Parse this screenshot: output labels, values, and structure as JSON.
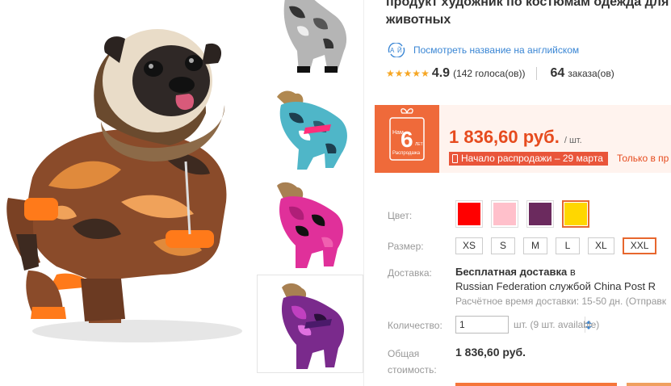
{
  "product": {
    "title_line1": "продукт художник по костюмам одежда для",
    "title_line2": "животных",
    "translate_link": "Посмотреть название на английском",
    "rating": {
      "stars": 5,
      "value": "4.9",
      "votes": "(142 голоса(ов))",
      "orders_count": "64",
      "orders_label": "заказа(ов)"
    }
  },
  "price_box": {
    "badge_text": "Нам",
    "badge_number": "6",
    "badge_sub": "ЛЕТ",
    "badge_caption": "Распродажа",
    "price": "1 836,60 руб.",
    "unit": "/ шт.",
    "sale_pill": "Начало распродажи – 29 марта",
    "only_app": "Только в пр"
  },
  "options": {
    "color_label": "Цвет:",
    "colors": [
      "#ff0000",
      "#ffc0cb",
      "#6b2a5e",
      "#ffd700"
    ],
    "selected_color_index": 3,
    "size_label": "Размер:",
    "sizes": [
      "XS",
      "S",
      "M",
      "L",
      "XL",
      "XXL"
    ],
    "selected_size_index": 5
  },
  "delivery": {
    "label": "Доставка:",
    "line1_bold": "Бесплатная доставка",
    "line1_rest": " в",
    "line2": "Russian Federation службой China Post R",
    "line3": "Расчётное время доставки: 15-50 дн. (Отправк"
  },
  "quantity": {
    "label": "Количество:",
    "value": "1",
    "note": "шт. (9 шт. available)"
  },
  "total": {
    "label_line1": "Общая",
    "label_line2": "стоимость:",
    "value": "1 836,60 руб."
  }
}
